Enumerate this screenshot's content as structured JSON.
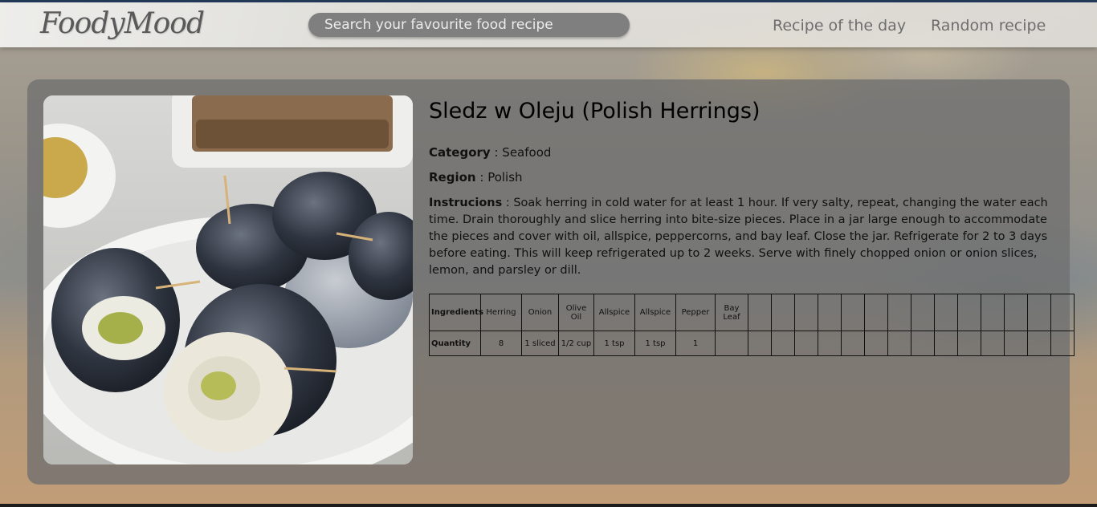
{
  "header": {
    "logo": "FoodyMood",
    "search_placeholder": "Search your favourite food recipe",
    "nav": {
      "recipe_of_day": "Recipe of the day",
      "random_recipe": "Random recipe"
    }
  },
  "recipe": {
    "title": "Sledz w Oleju (Polish Herrings)",
    "category_label": "Category",
    "category": "Seafood",
    "region_label": "Region",
    "region": "Polish",
    "instructions_label": "Instrucions",
    "instructions": "Soak herring in cold water for at least 1 hour. If very salty, repeat, changing the water each time. Drain thoroughly and slice herring into bite-size pieces. Place in a jar large enough to accommodate the pieces and cover with oil, allspice, peppercorns, and bay leaf. Close the jar. Refrigerate for 2 to 3 days before eating. This will keep refrigerated up to 2 weeks. Serve with finely chopped onion or onion slices, lemon, and parsley or dill.",
    "image_alt": "sledz-w-oleju-photo"
  },
  "ingredients_table": {
    "ingredients_label": "Ingredients",
    "quantity_label": "Quantity",
    "ingredients": [
      "Herring",
      "Onion",
      "Olive Oil",
      "Allspice",
      "Allspice",
      "Pepper",
      "Bay Leaf",
      "",
      "",
      "",
      "",
      "",
      "",
      "",
      "",
      "",
      "",
      "",
      "",
      "",
      ""
    ],
    "quantities": [
      "8",
      "1 sliced",
      "1/2 cup",
      "1 tsp",
      "1 tsp",
      "1",
      "",
      "",
      "",
      "",
      "",
      "",
      "",
      "",
      "",
      "",
      "",
      "",
      "",
      "",
      ""
    ]
  }
}
